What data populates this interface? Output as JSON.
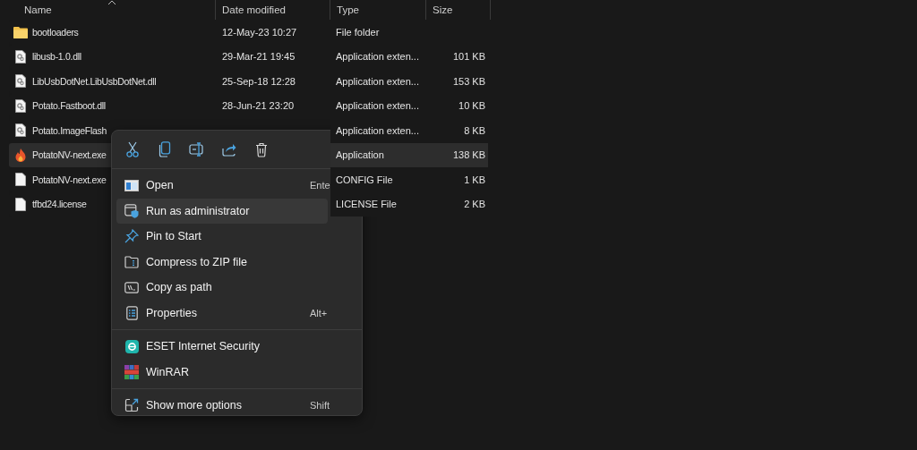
{
  "columns": [
    {
      "label": "Name",
      "sorted": true
    },
    {
      "label": "Date modified",
      "sorted": false
    },
    {
      "label": "Type",
      "sorted": false
    },
    {
      "label": "Size",
      "sorted": false
    }
  ],
  "rows": [
    {
      "kind": "folder",
      "name": "bootloaders",
      "date": "12-May-23 10:27",
      "type": "File folder",
      "selected": false
    },
    {
      "kind": "dll",
      "name": "libusb-1.0.dll",
      "date": "29-Mar-21 19:45",
      "type": "Application exten...",
      "size": "101 KB",
      "selected": false
    },
    {
      "kind": "dll",
      "name": "LibUsbDotNet.LibUsbDotNet.dll",
      "date": "25-Sep-18 12:28",
      "type": "Application exten...",
      "size": "153 KB",
      "selected": false
    },
    {
      "kind": "dll",
      "name": "Potato.Fastboot.dll",
      "date": "28-Jun-21 23:20",
      "type": "Application exten...",
      "size": "10 KB",
      "selected": false
    },
    {
      "kind": "dll",
      "name": "Potato.ImageFlash",
      "type": "Application exten...",
      "size": "8 KB",
      "selected": false
    },
    {
      "kind": "exe",
      "name": "PotatoNV-next.exe",
      "type": "Application",
      "size": "138 KB",
      "selected": true
    },
    {
      "kind": "file",
      "name": "PotatoNV-next.exe",
      "type": "CONFIG File",
      "size": "1 KB",
      "selected": false
    },
    {
      "kind": "file",
      "name": "tfbd24.license",
      "type": "LICENSE File",
      "size": "2 KB",
      "selected": false
    }
  ],
  "context_menu": {
    "groups": [
      [
        {
          "kind": "open",
          "label": "Open",
          "shortcut": "Ente",
          "highlighted": false
        },
        {
          "kind": "admin",
          "label": "Run as administrator",
          "highlighted": true
        },
        {
          "kind": "pin",
          "label": "Pin to Start",
          "highlighted": false
        },
        {
          "kind": "zip",
          "label": "Compress to ZIP file",
          "highlighted": false
        },
        {
          "kind": "path",
          "label": "Copy as path",
          "highlighted": false
        },
        {
          "kind": "properties",
          "label": "Properties",
          "shortcut": "Alt+",
          "highlighted": false
        }
      ],
      [
        {
          "kind": "eset",
          "label": "ESET Internet Security",
          "highlighted": false
        },
        {
          "kind": "winrar",
          "label": "WinRAR",
          "highlighted": false
        }
      ],
      [
        {
          "kind": "more",
          "label": "Show more options",
          "shortcut": "Shift",
          "highlighted": false
        }
      ]
    ]
  }
}
